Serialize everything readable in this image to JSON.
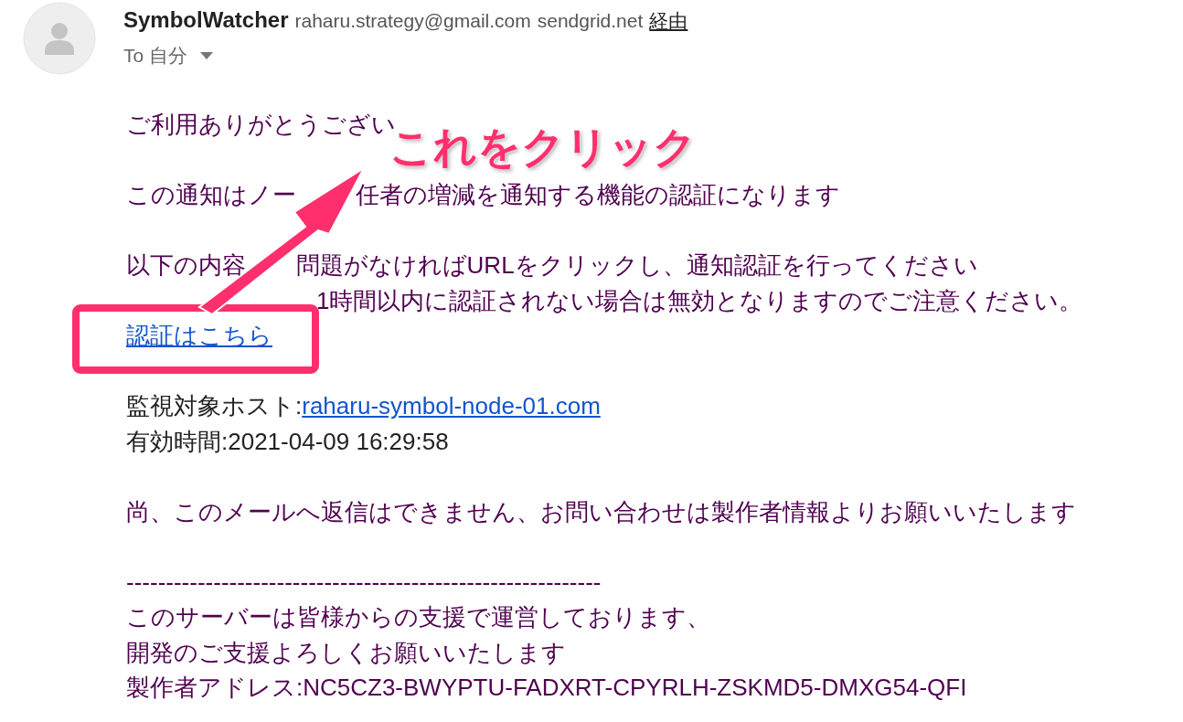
{
  "sender": {
    "name": "SymbolWatcher",
    "email": "raharu.strategy@gmail.com",
    "via_domain": "sendgrid.net",
    "via_label": "経由"
  },
  "recipient": {
    "label": "To 自分"
  },
  "body": [
    {
      "kind": "text",
      "parts": [
        "ご利用ありがとうござい"
      ],
      "color": "#500050"
    },
    {
      "kind": "blank"
    },
    {
      "kind": "text",
      "parts": [
        "この通知はノー",
        "任者の増減を通知する機能の認証になります"
      ],
      "color": "#500050"
    },
    {
      "kind": "blank"
    },
    {
      "kind": "text",
      "parts": [
        "以下の内容",
        "問題がなければURLをクリックし、通知認証を行ってください"
      ],
      "color": "#500050"
    },
    {
      "kind": "text",
      "parts": [
        "1時間以内に認証されない場合は無効となりますのでご注意ください。"
      ],
      "color": "#500050"
    },
    {
      "kind": "link",
      "text": "認証はこちら"
    },
    {
      "kind": "blank"
    },
    {
      "kind": "label_link",
      "label": "監視対象ホスト:",
      "text": "raharu-symbol-node-01.com",
      "color": "#222222"
    },
    {
      "kind": "text",
      "parts": [
        "有効時間:2021-04-09 16:29:58"
      ],
      "color": "#222222"
    },
    {
      "kind": "blank"
    },
    {
      "kind": "text",
      "parts": [
        "尚、このメールへ返信はできません、お問い合わせは製作者情報よりお願いいたします"
      ],
      "color": "#500050"
    },
    {
      "kind": "blank"
    },
    {
      "kind": "text",
      "parts": [
        "------------------------------------------------------------"
      ],
      "color": "#500050"
    },
    {
      "kind": "text",
      "parts": [
        "このサーバーは皆様からの支援で運営しております、"
      ],
      "color": "#500050"
    },
    {
      "kind": "text",
      "parts": [
        "開発のご支援よろしくお願いいたします"
      ],
      "color": "#500050"
    },
    {
      "kind": "text",
      "parts": [
        "製作者アドレス:NC5CZ3-BWYPTU-FADXRT-CPYRLH-ZSKMD5-DMXG54-QFI"
      ],
      "color": "#500050"
    }
  ],
  "annotation": {
    "callout": "これをクリック"
  }
}
